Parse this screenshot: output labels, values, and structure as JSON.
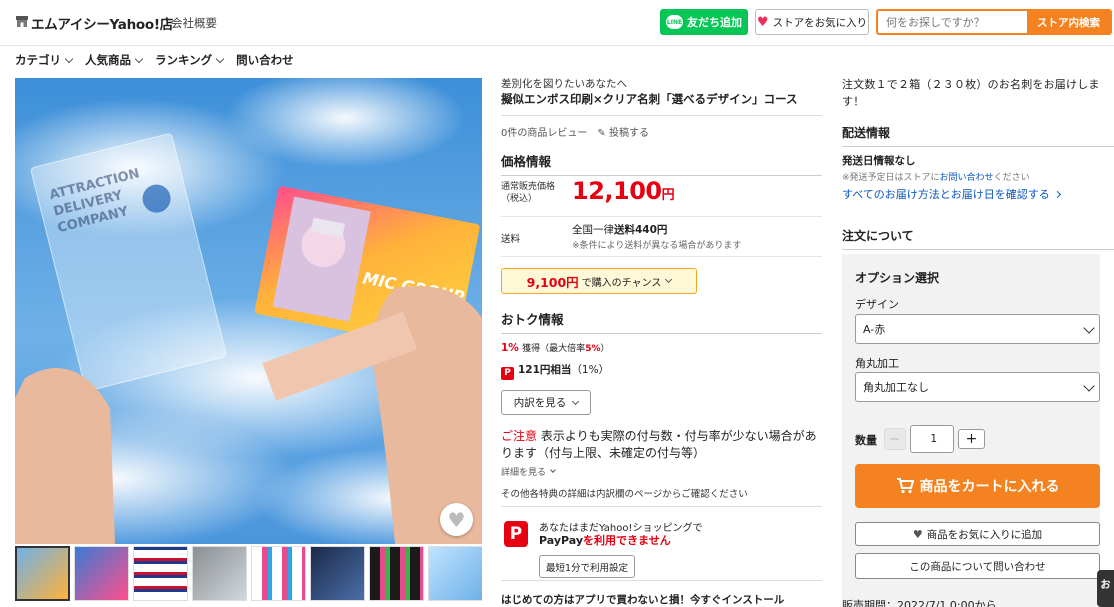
{
  "header": {
    "store_name": "エムアイシーYahoo!店",
    "company_link": "会社概要",
    "line_button": "友だち追加",
    "line_logo": "LINE",
    "fav_store_button": "ストアをお気に入り",
    "search_placeholder": "何をお探しですか？",
    "search_button": "ストア内検索"
  },
  "nav": {
    "items": [
      "カテゴリ",
      "人気商品",
      "ランキング",
      "問い合わせ"
    ]
  },
  "product": {
    "catch": "差別化を図りたいあなたへ",
    "title": "擬似エンボス印刷×クリア名刺「選べるデザイン」コース",
    "review_count": "0件の商品レビュー",
    "post_review": "投稿する",
    "image_text": {
      "clear_card": "ATTRACTION DELIVERY COMPANY",
      "logo": "MIC GROUP"
    }
  },
  "price": {
    "section_title": "価格情報",
    "label_line1": "通常販売価格",
    "label_line2": "（税込）",
    "amount": "12,100",
    "currency": "円",
    "shipping_label": "送料",
    "shipping_prefix": "全国一律",
    "shipping_value": "送料440円",
    "shipping_note": "※条件により送料が異なる場合があります",
    "chance_amount": "9,100円",
    "chance_text": "で購入のチャンス"
  },
  "points": {
    "section_title": "おトク情報",
    "rate": "1%",
    "earn": "獲得（最大倍率",
    "max_rate": "5%",
    "close": "）",
    "paypay_icon": "P",
    "equiv": "121円相当",
    "equiv_rate": "（1%）",
    "breakdown_button": "内訳を見る",
    "notice_head": "ご注意",
    "notice_body": "表示よりも実際の付与数・付与率が少ない場合があります（付与上限、未確定の付与等）",
    "detail_link": "詳細を見る",
    "other_note": "その他各特典の詳細は内訳欄のページからご確認ください"
  },
  "paypay": {
    "logo": "P",
    "line1": "あなたはまだYahoo!ショッピングで",
    "line2_prefix": "PayPay",
    "line2_suffix": "を利用できません",
    "setup_button": "最短1分で利用設定"
  },
  "app_promo": "はじめての方はアプリで買わないと損！今すぐインストール",
  "right": {
    "order_note": "注文数１で２箱（２３０枚）のお名刺をお届けします！",
    "delivery_title": "配送情報",
    "ship_date": "発送日情報なし",
    "ship_store_prefix": "※発送予定日はストアに",
    "ship_store_link": "お問い合わせ",
    "ship_store_suffix": "ください",
    "delivery_link": "すべてのお届け方法とお届け日を確認する",
    "order_title": "注文について",
    "options_title": "オプション選択",
    "design_label": "デザイン",
    "design_value": "A-赤",
    "corner_label": "角丸加工",
    "corner_value": "角丸加工なし",
    "qty_label": "数量",
    "qty_value": "1",
    "cart_button": "商品をカートに入れる",
    "fav_item_button": "商品をお気に入りに追加",
    "inquiry_button": "この商品について問い合わせ",
    "sale_period": "販売期間：2022/7/1 0:00から"
  },
  "side_tab": "お",
  "colors": {
    "accent": "#f58220",
    "price": "#e60012",
    "line": "#06c755",
    "link": "#0a56c2"
  }
}
